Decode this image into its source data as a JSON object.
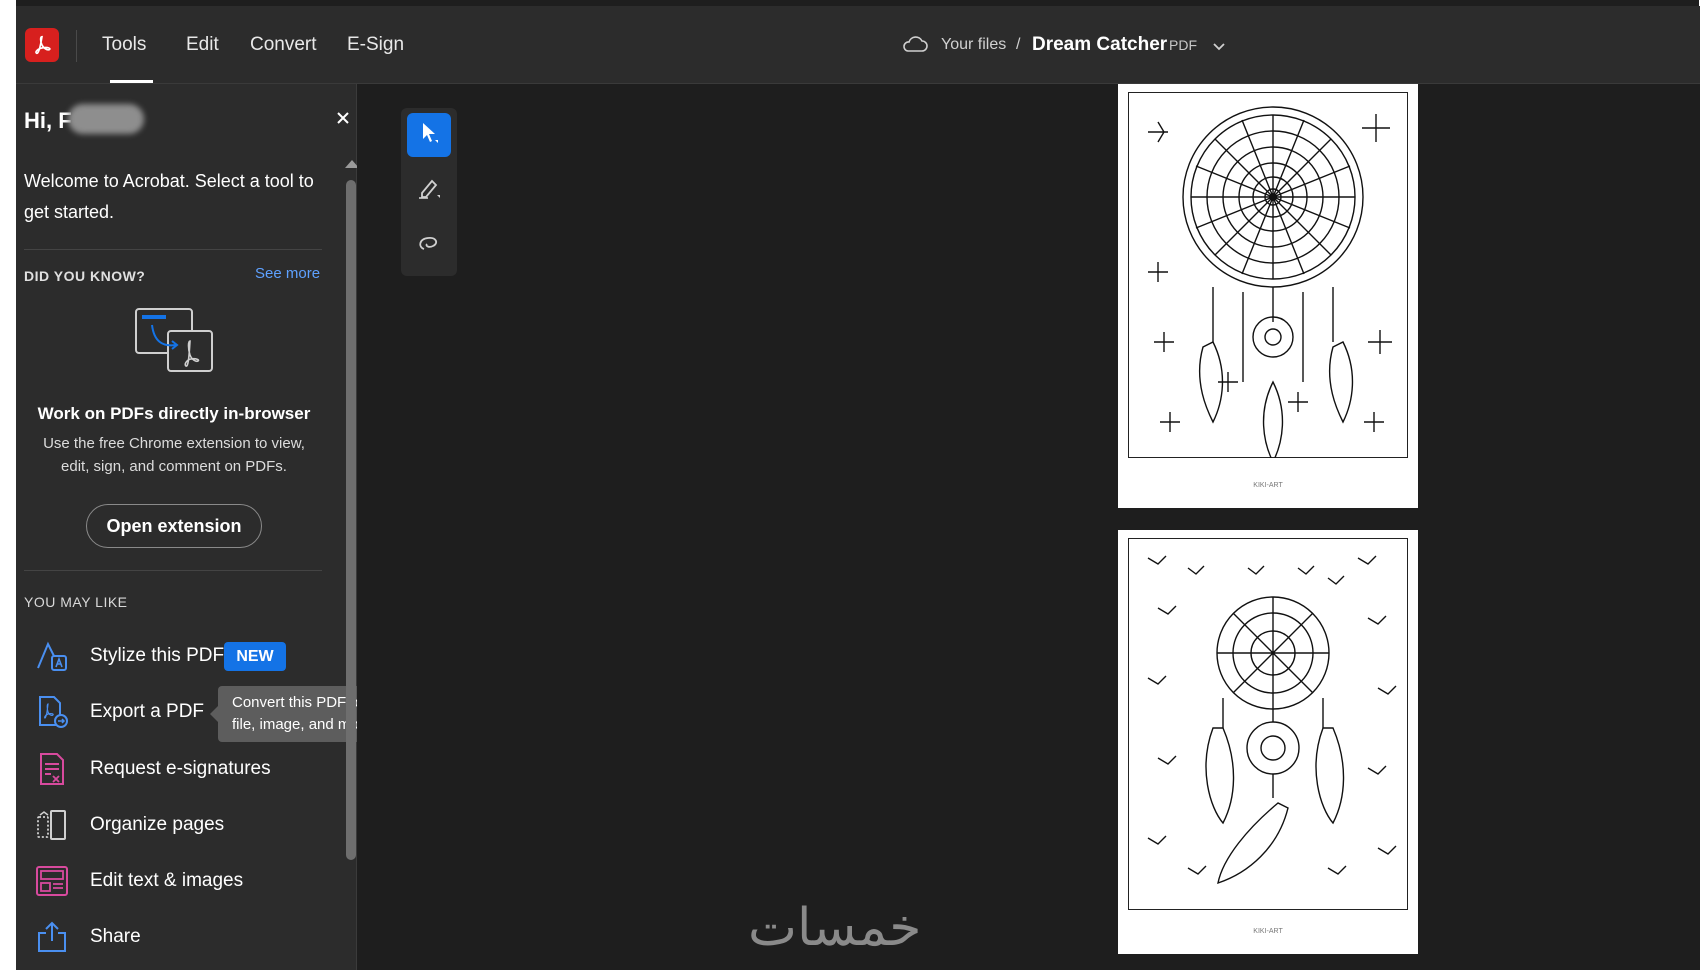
{
  "header": {
    "nav_tabs": [
      "Tools",
      "Edit",
      "Convert",
      "E-Sign"
    ],
    "breadcrumb": {
      "root": "Your files",
      "separator": "/",
      "file_name": "Dream Catcher",
      "file_type": "PDF"
    }
  },
  "sidebar": {
    "greeting": "Hi, F",
    "welcome": "Welcome to Acrobat. Select a tool to get started.",
    "did_you_know": {
      "heading": "DID YOU KNOW?",
      "see_more": "See more",
      "title": "Work on PDFs directly in-browser",
      "body": "Use the free Chrome extension to view, edit, sign, and comment on PDFs.",
      "button": "Open extension"
    },
    "you_may_like": {
      "heading": "YOU MAY LIKE",
      "items": [
        {
          "label": "Stylize this PDF",
          "icon": "stylize-icon"
        },
        {
          "label": "Export a PDF",
          "icon": "export-pdf-icon"
        },
        {
          "label": "Request e-signatures",
          "icon": "request-signature-icon"
        },
        {
          "label": "Organize pages",
          "icon": "organize-pages-icon"
        },
        {
          "label": "Edit text & images",
          "icon": "edit-text-images-icon"
        },
        {
          "label": "Share",
          "icon": "share-icon"
        }
      ],
      "new_badge": "NEW",
      "tooltip": "Convert this PDF to a Microsoft Office file, image, and more"
    }
  },
  "pages": [
    {
      "footer": "KIKI-ART"
    },
    {
      "footer": "KIKI-ART"
    }
  ],
  "watermark": "خمسات",
  "colors": {
    "accent": "#1473e6",
    "brand_red": "#d7201e",
    "panel": "#2c2c2c",
    "canvas": "#1e1e1e"
  }
}
